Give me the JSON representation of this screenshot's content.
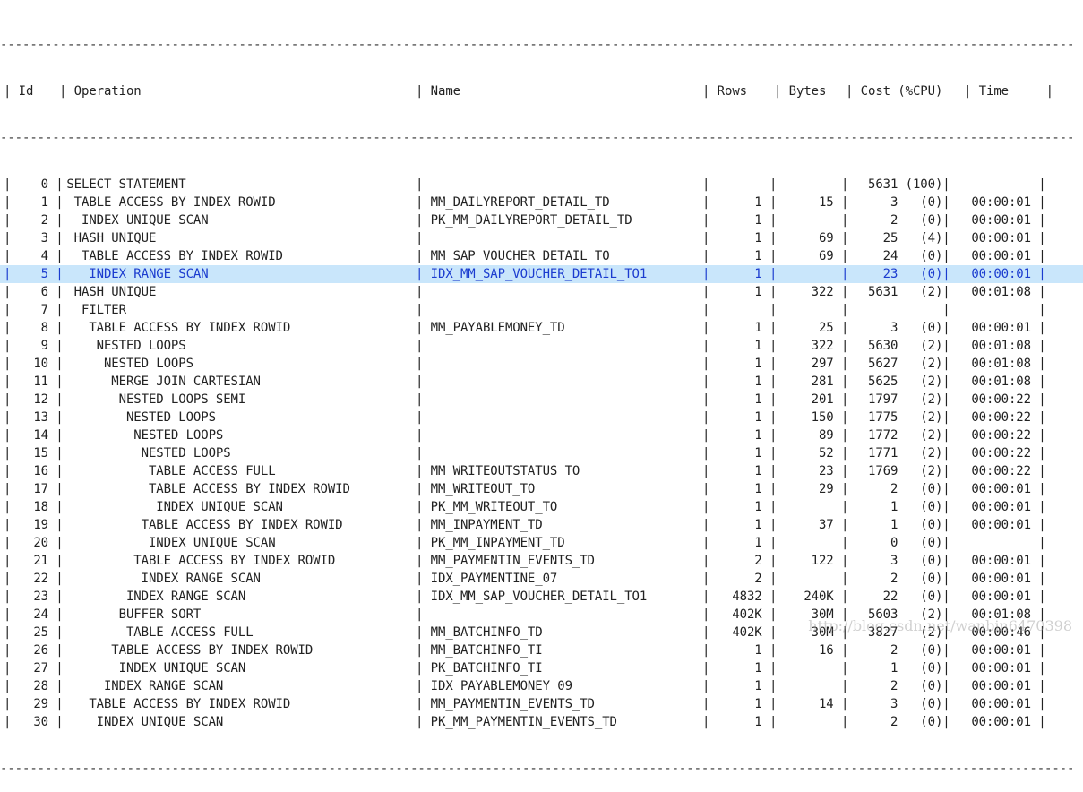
{
  "header": {
    "id": "| Id",
    "op": "| Operation",
    "name": "| Name",
    "rows": "| Rows",
    "bytes": "| Bytes",
    "cost": "| Cost (%CPU)",
    "time": "| Time     |"
  },
  "rows": [
    {
      "id": "   0",
      "op": "SELECT STATEMENT",
      "name": "",
      "rows": "",
      "bytes": "",
      "cost": "5631",
      "cpu": "(100)",
      "time": ""
    },
    {
      "id": "   1",
      "op": " TABLE ACCESS BY INDEX ROWID",
      "name": "MM_DAILYREPORT_DETAIL_TD",
      "rows": "1",
      "bytes": "15",
      "cost": "3",
      "cpu": "(0)",
      "time": "00:00:01"
    },
    {
      "id": "   2",
      "op": "  INDEX UNIQUE SCAN",
      "name": "PK_MM_DAILYREPORT_DETAIL_TD",
      "rows": "1",
      "bytes": "",
      "cost": "2",
      "cpu": "(0)",
      "time": "00:00:01"
    },
    {
      "id": "   3",
      "op": " HASH UNIQUE",
      "name": "",
      "rows": "1",
      "bytes": "69",
      "cost": "25",
      "cpu": "(4)",
      "time": "00:00:01"
    },
    {
      "id": "   4",
      "op": "  TABLE ACCESS BY INDEX ROWID",
      "name": "MM_SAP_VOUCHER_DETAIL_TO",
      "rows": "1",
      "bytes": "69",
      "cost": "24",
      "cpu": "(0)",
      "time": "00:00:01"
    },
    {
      "id": "   5",
      "op": "   INDEX RANGE SCAN",
      "name": "IDX_MM_SAP_VOUCHER_DETAIL_TO1",
      "rows": "1",
      "bytes": "",
      "cost": "23",
      "cpu": "(0)",
      "time": "00:00:01",
      "highlight": true
    },
    {
      "id": "   6",
      "op": " HASH UNIQUE",
      "name": "",
      "rows": "1",
      "bytes": "322",
      "cost": "5631",
      "cpu": "(2)",
      "time": "00:01:08"
    },
    {
      "id": "   7",
      "op": "  FILTER",
      "name": "",
      "rows": "",
      "bytes": "",
      "cost": "",
      "cpu": "",
      "time": ""
    },
    {
      "id": "   8",
      "op": "   TABLE ACCESS BY INDEX ROWID",
      "name": "MM_PAYABLEMONEY_TD",
      "rows": "1",
      "bytes": "25",
      "cost": "3",
      "cpu": "(0)",
      "time": "00:00:01"
    },
    {
      "id": "   9",
      "op": "    NESTED LOOPS",
      "name": "",
      "rows": "1",
      "bytes": "322",
      "cost": "5630",
      "cpu": "(2)",
      "time": "00:01:08"
    },
    {
      "id": "  10",
      "op": "     NESTED LOOPS",
      "name": "",
      "rows": "1",
      "bytes": "297",
      "cost": "5627",
      "cpu": "(2)",
      "time": "00:01:08"
    },
    {
      "id": "  11",
      "op": "      MERGE JOIN CARTESIAN",
      "name": "",
      "rows": "1",
      "bytes": "281",
      "cost": "5625",
      "cpu": "(2)",
      "time": "00:01:08"
    },
    {
      "id": "  12",
      "op": "       NESTED LOOPS SEMI",
      "name": "",
      "rows": "1",
      "bytes": "201",
      "cost": "1797",
      "cpu": "(2)",
      "time": "00:00:22"
    },
    {
      "id": "  13",
      "op": "        NESTED LOOPS",
      "name": "",
      "rows": "1",
      "bytes": "150",
      "cost": "1775",
      "cpu": "(2)",
      "time": "00:00:22"
    },
    {
      "id": "  14",
      "op": "         NESTED LOOPS",
      "name": "",
      "rows": "1",
      "bytes": "89",
      "cost": "1772",
      "cpu": "(2)",
      "time": "00:00:22"
    },
    {
      "id": "  15",
      "op": "          NESTED LOOPS",
      "name": "",
      "rows": "1",
      "bytes": "52",
      "cost": "1771",
      "cpu": "(2)",
      "time": "00:00:22"
    },
    {
      "id": "  16",
      "op": "           TABLE ACCESS FULL",
      "name": "MM_WRITEOUTSTATUS_TO",
      "rows": "1",
      "bytes": "23",
      "cost": "1769",
      "cpu": "(2)",
      "time": "00:00:22"
    },
    {
      "id": "  17",
      "op": "           TABLE ACCESS BY INDEX ROWID",
      "name": "MM_WRITEOUT_TO",
      "rows": "1",
      "bytes": "29",
      "cost": "2",
      "cpu": "(0)",
      "time": "00:00:01"
    },
    {
      "id": "  18",
      "op": "            INDEX UNIQUE SCAN",
      "name": "PK_MM_WRITEOUT_TO",
      "rows": "1",
      "bytes": "",
      "cost": "1",
      "cpu": "(0)",
      "time": "00:00:01"
    },
    {
      "id": "  19",
      "op": "          TABLE ACCESS BY INDEX ROWID",
      "name": "MM_INPAYMENT_TD",
      "rows": "1",
      "bytes": "37",
      "cost": "1",
      "cpu": "(0)",
      "time": "00:00:01"
    },
    {
      "id": "  20",
      "op": "           INDEX UNIQUE SCAN",
      "name": "PK_MM_INPAYMENT_TD",
      "rows": "1",
      "bytes": "",
      "cost": "0",
      "cpu": "(0)",
      "time": ""
    },
    {
      "id": "  21",
      "op": "         TABLE ACCESS BY INDEX ROWID",
      "name": "MM_PAYMENTIN_EVENTS_TD",
      "rows": "2",
      "bytes": "122",
      "cost": "3",
      "cpu": "(0)",
      "time": "00:00:01"
    },
    {
      "id": "  22",
      "op": "          INDEX RANGE SCAN",
      "name": "IDX_PAYMENTINE_07",
      "rows": "2",
      "bytes": "",
      "cost": "2",
      "cpu": "(0)",
      "time": "00:00:01"
    },
    {
      "id": "  23",
      "op": "        INDEX RANGE SCAN",
      "name": "IDX_MM_SAP_VOUCHER_DETAIL_TO1",
      "rows": "4832",
      "bytes": "240K",
      "cost": "22",
      "cpu": "(0)",
      "time": "00:00:01"
    },
    {
      "id": "  24",
      "op": "       BUFFER SORT",
      "name": "",
      "rows": "402K",
      "bytes": "30M",
      "cost": "5603",
      "cpu": "(2)",
      "time": "00:01:08"
    },
    {
      "id": "  25",
      "op": "        TABLE ACCESS FULL",
      "name": "MM_BATCHINFO_TD",
      "rows": "402K",
      "bytes": "30M",
      "cost": "3827",
      "cpu": "(2)",
      "time": "00:00:46"
    },
    {
      "id": "  26",
      "op": "      TABLE ACCESS BY INDEX ROWID",
      "name": "MM_BATCHINFO_TI",
      "rows": "1",
      "bytes": "16",
      "cost": "2",
      "cpu": "(0)",
      "time": "00:00:01"
    },
    {
      "id": "  27",
      "op": "       INDEX UNIQUE SCAN",
      "name": "PK_BATCHINFO_TI",
      "rows": "1",
      "bytes": "",
      "cost": "1",
      "cpu": "(0)",
      "time": "00:00:01"
    },
    {
      "id": "  28",
      "op": "     INDEX RANGE SCAN",
      "name": "IDX_PAYABLEMONEY_09",
      "rows": "1",
      "bytes": "",
      "cost": "2",
      "cpu": "(0)",
      "time": "00:00:01"
    },
    {
      "id": "  29",
      "op": "   TABLE ACCESS BY INDEX ROWID",
      "name": "MM_PAYMENTIN_EVENTS_TD",
      "rows": "1",
      "bytes": "14",
      "cost": "3",
      "cpu": "(0)",
      "time": "00:00:01"
    },
    {
      "id": "  30",
      "op": "    INDEX UNIQUE SCAN",
      "name": "PK_MM_PAYMENTIN_EVENTS_TD",
      "rows": "1",
      "bytes": "",
      "cost": "2",
      "cpu": "(0)",
      "time": "00:00:01"
    }
  ],
  "watermark": "http://blog.csdn.net/wanbin6470398",
  "colors": {
    "highlight_bg": "#c9e6fb",
    "highlight_text": "#1b3ccf"
  }
}
